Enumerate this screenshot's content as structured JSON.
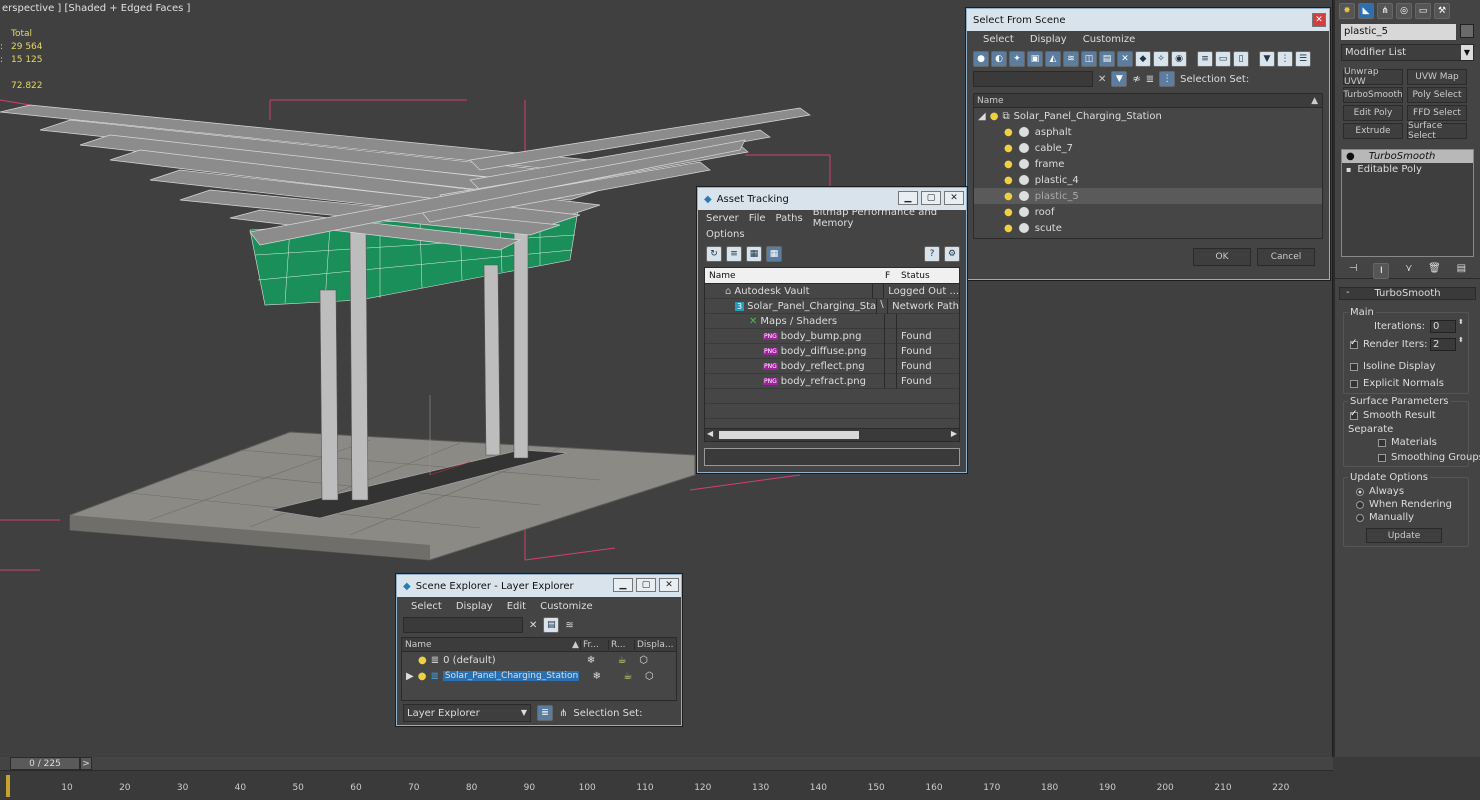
{
  "viewport": {
    "label": "erspective ] [Shaded + Edged Faces ]",
    "stats": {
      "total_label": "Total",
      "polys": "29 564",
      "verts": "15 125",
      "fps": "72.822",
      "colon1": ":",
      "colon2": ":"
    },
    "colors": {
      "ground": "#8c8a84",
      "canopy": "#8a8a8a",
      "panel_green": "#1b8f5a",
      "bbox": "#d04070"
    }
  },
  "select_from_scene": {
    "title": "Select From Scene",
    "menu": [
      "Select",
      "Display",
      "Customize"
    ],
    "selection_set_label": "Selection Set:",
    "column_name": "Name",
    "root": "Solar_Panel_Charging_Station",
    "items": [
      "asphalt",
      "cable_7",
      "frame",
      "plastic_4",
      "plastic_5",
      "roof",
      "scute"
    ],
    "selected_item": "plastic_5",
    "ok_label": "OK",
    "cancel_label": "Cancel"
  },
  "asset_tracking": {
    "title": "Asset Tracking",
    "menu": [
      "Server",
      "File",
      "Paths",
      "Bitmap Performance and Memory"
    ],
    "menu2": "Options",
    "columns": {
      "name": "Name",
      "f": "F",
      "status": "Status"
    },
    "rows": [
      {
        "name": "Autodesk Vault",
        "f": "",
        "status": "Logged Out ..."
      },
      {
        "name": "Solar_Panel_Charging_Statio...",
        "f": "\\",
        "status": "Network Path"
      },
      {
        "name": "Maps / Shaders",
        "f": "",
        "status": ""
      },
      {
        "name": "body_bump.png",
        "f": "",
        "status": "Found"
      },
      {
        "name": "body_diffuse.png",
        "f": "",
        "status": "Found"
      },
      {
        "name": "body_reflect.png",
        "f": "",
        "status": "Found"
      },
      {
        "name": "body_refract.png",
        "f": "",
        "status": "Found"
      }
    ],
    "png_badge": "PNG"
  },
  "scene_explorer": {
    "title": "Scene Explorer - Layer Explorer",
    "menu": [
      "Select",
      "Display",
      "Edit",
      "Customize"
    ],
    "columns": {
      "name": "Name",
      "frozen": "Fr...",
      "render": "R...",
      "display": "Displa..."
    },
    "layers": [
      "0 (default)",
      "Solar_Panel_Charging_Station"
    ],
    "footer_dropdown": "Layer Explorer",
    "selection_set_label": "Selection Set:"
  },
  "command_panel": {
    "object_name": "plastic_5",
    "modifier_list": "Modifier List",
    "buttons": [
      "Unwrap UVW",
      "UVW Map",
      "TurboSmooth",
      "Poly Select",
      "Edit Poly",
      "FFD Select",
      "Extrude",
      "Surface Select"
    ],
    "stack": [
      "TurboSmooth",
      "Editable Poly"
    ],
    "rollout_title": "TurboSmooth",
    "main_label": "Main",
    "iterations_label": "Iterations:",
    "iterations": "0",
    "render_iters_label": "Render Iters:",
    "render_iters": "2",
    "isoline_label": "Isoline Display",
    "explicit_normals_label": "Explicit Normals",
    "surface_params_label": "Surface Parameters",
    "smooth_result_label": "Smooth Result",
    "separate_label": "Separate",
    "materials_label": "Materials",
    "smoothing_groups_label": "Smoothing Groups",
    "update_options_label": "Update Options",
    "always_label": "Always",
    "when_rendering_label": "When Rendering",
    "manually_label": "Manually",
    "update_button": "Update"
  },
  "timeline": {
    "frame_counter": "0 / 225",
    "next": ">",
    "ticks": [
      "10",
      "20",
      "30",
      "40",
      "50",
      "60",
      "70",
      "80",
      "90",
      "100",
      "110",
      "120",
      "130",
      "140",
      "150",
      "160",
      "170",
      "180",
      "190",
      "200",
      "210",
      "220"
    ]
  }
}
